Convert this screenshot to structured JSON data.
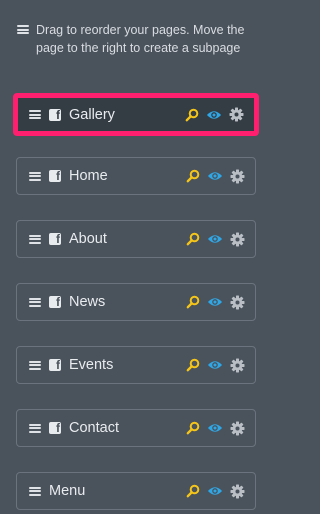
{
  "hint": {
    "text": "Drag to reorder your pages. Move the page to the right to create a subpage"
  },
  "colors": {
    "search": "#f5c518",
    "eye": "#2fa7e6",
    "gear": "#b9bfc5",
    "selected_border": "#ff1f6e"
  },
  "pages": [
    {
      "label": "Gallery",
      "icon": "facebook-icon",
      "selected": true
    },
    {
      "label": "Home",
      "icon": "facebook-icon"
    },
    {
      "label": "About",
      "icon": "facebook-icon"
    },
    {
      "label": "News",
      "icon": "facebook-icon"
    },
    {
      "label": "Events",
      "icon": "facebook-icon"
    },
    {
      "label": "Contact",
      "icon": "facebook-icon"
    },
    {
      "label": "Menu",
      "icon": ""
    }
  ]
}
